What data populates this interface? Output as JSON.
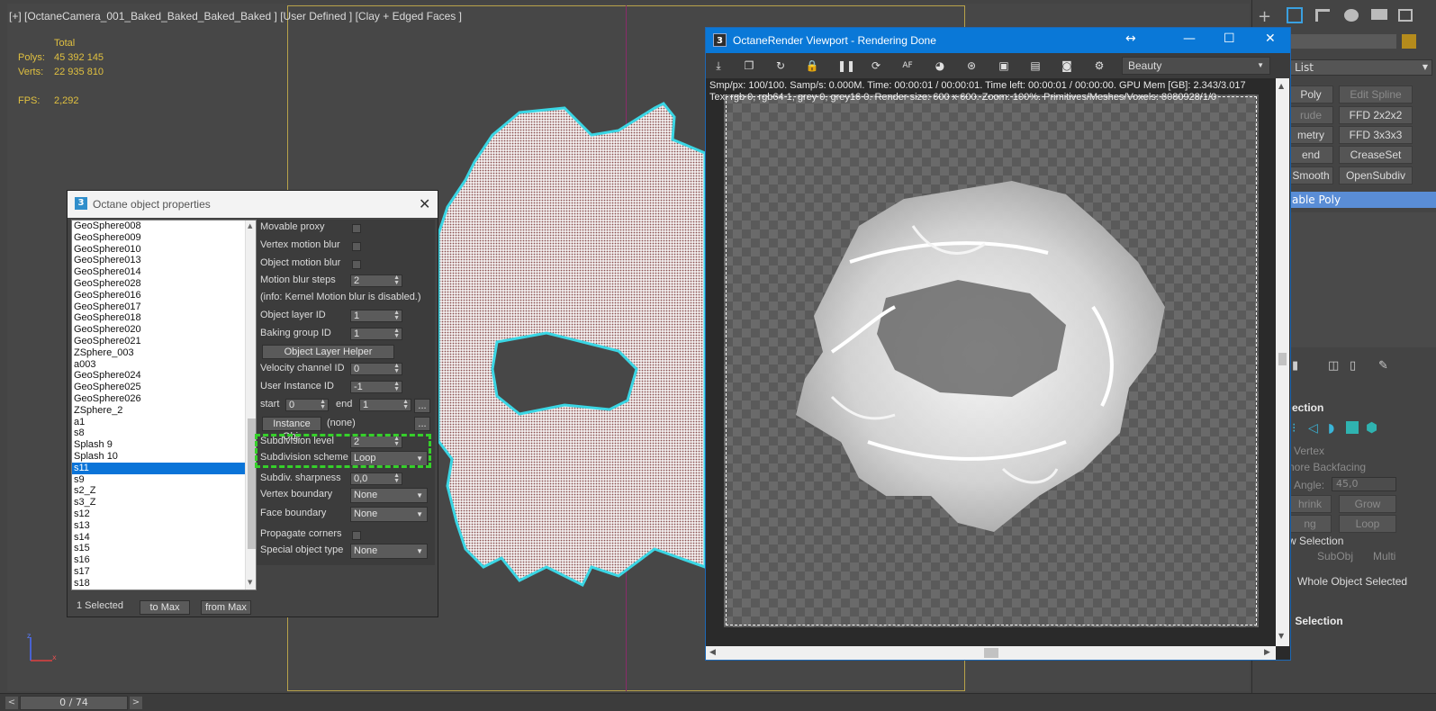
{
  "viewport": {
    "label": "[+] [OctaneCamera_001_Baked_Baked_Baked_Baked ] [User Defined ] [Clay + Edged Faces ]",
    "stats": {
      "total_label": "Total",
      "polys_label": "Polys:",
      "polys_value": "45 392 145",
      "verts_label": "Verts:",
      "verts_value": "22 935 810",
      "fps_label": "FPS:",
      "fps_value": "2,292"
    },
    "gizmo": {
      "z": "z",
      "x": "x"
    }
  },
  "timeline": {
    "left_arrow": "<",
    "frame": "0 / 74",
    "right_arrow": ">"
  },
  "command_panel": {
    "dropdown_label": "List",
    "buttons": [
      {
        "label": "Poly",
        "dim": false
      },
      {
        "label": "Edit Spline",
        "dim": true
      },
      {
        "label": "rude",
        "dim": true
      },
      {
        "label": "FFD 2x2x2",
        "dim": false
      },
      {
        "label": "metry",
        "dim": false
      },
      {
        "label": "FFD 3x3x3",
        "dim": false
      },
      {
        "label": "end",
        "dim": false
      },
      {
        "label": "CreaseSet",
        "dim": false
      },
      {
        "label": "Smooth",
        "dim": false
      },
      {
        "label": "OpenSubdiv",
        "dim": false
      }
    ],
    "stack_item": "able Poly",
    "selection_header": "ection",
    "by_vertex": "Vertex",
    "ignore_backfacing": "nore Backfacing",
    "angle_label": "Angle:",
    "angle_value": "45,0",
    "shrink": "hrink",
    "grow": "Grow",
    "ring": "ng",
    "loop": "Loop",
    "preview_selection": "w Selection",
    "subobj": "SubObj",
    "multi": "Multi",
    "whole_object_selected": "Whole Object Selected",
    "soft_selection": ": Selection"
  },
  "object_properties": {
    "title": "Octane object properties",
    "icon": "3",
    "objects": [
      "GeoSphere008",
      "GeoSphere009",
      "GeoSphere010",
      "GeoSphere013",
      "GeoSphere014",
      "GeoSphere028",
      "GeoSphere016",
      "GeoSphere017",
      "GeoSphere018",
      "GeoSphere020",
      "GeoSphere021",
      "ZSphere_003",
      "a003",
      "GeoSphere024",
      "GeoSphere025",
      "GeoSphere026",
      "ZSphere_2",
      "a1",
      "s8",
      "Splash 9",
      "Splash 10",
      "s11",
      "s9",
      "s2_Z",
      "s3_Z",
      "s12",
      "s13",
      "s14",
      "s15",
      "s16",
      "s17",
      "s18"
    ],
    "selected_object": "s11",
    "props": {
      "movable_proxy": "Movable proxy",
      "vertex_motion_blur": "Vertex motion blur",
      "object_motion_blur": "Object motion blur",
      "motion_blur_steps": "Motion blur steps",
      "motion_blur_steps_value": "2",
      "info": "(info: Kernel Motion blur is disabled.)",
      "object_layer_id": "Object layer ID",
      "object_layer_id_value": "1",
      "baking_group_id": "Baking group ID",
      "baking_group_id_value": "1",
      "object_layer_helper": "Object Layer Helper",
      "velocity_channel_id": "Velocity channel ID",
      "velocity_channel_id_value": "0",
      "user_instance_id": "User Instance ID",
      "user_instance_id_value": "-1",
      "start": "start",
      "start_value": "0",
      "end": "end",
      "end_value": "1",
      "more": "...",
      "instance_obj": "Instance Obj:",
      "instance_obj_value": "(none)",
      "subdivision_level": "Subdivision level",
      "subdivision_level_value": "2",
      "subdivision_scheme": "Subdivision scheme",
      "subdivision_scheme_value": "Loop",
      "subdiv_sharpness": "Subdiv. sharpness",
      "subdiv_sharpness_value": "0,0",
      "vertex_boundary": "Vertex boundary",
      "vertex_boundary_value": "None",
      "face_boundary": "Face boundary",
      "face_boundary_value": "None",
      "propagate_corners": "Propagate corners",
      "special_object_type": "Special object type",
      "special_object_type_value": "None"
    },
    "footer": {
      "selected": "1 Selected",
      "to_max": "to Max",
      "from_max": "from Max"
    },
    "close": "✕"
  },
  "render_viewport": {
    "title": "OctaneRender Viewport - Rendering Done",
    "icon": "3",
    "pass_dropdown": "Beauty",
    "info_line1": "Smp/px: 100/100.   Samp/s: 0.000M.   Time: 00:00:01 / 00:00:01.   Time left: 00:00:01 / 00:00:00.   GPU Mem [GB]: 2.343/3.017",
    "info_line2": "Tex: rgb 0, rgb64 1, grey 0, grey16 0.   Render size: 600 x 600.   Zoom: 100%.   Primitives/Meshes/Voxels: 8080928/1/0",
    "controls": {
      "resize": "↔",
      "minimize": "—",
      "maximize": "☐",
      "close": "✕"
    }
  }
}
